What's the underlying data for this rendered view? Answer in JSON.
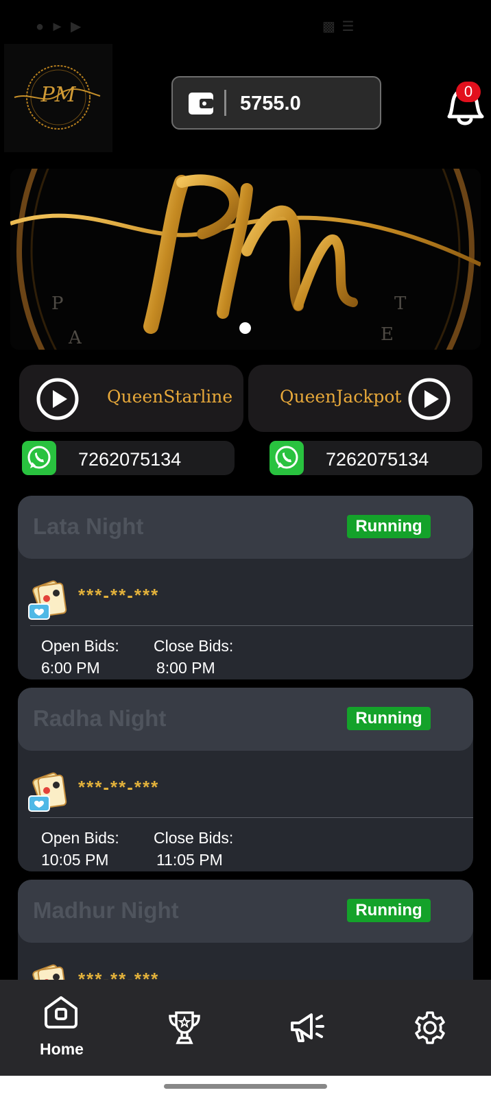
{
  "header": {
    "wallet_balance": "5755.0",
    "notification_count": "0"
  },
  "banner": {
    "icon": "pm-logo-banner"
  },
  "games": [
    {
      "label": "QueenStarline",
      "icon": "play-icon"
    },
    {
      "label": "QueenJackpot",
      "icon": "play-icon"
    }
  ],
  "contacts": [
    {
      "number": "7262075134",
      "icon": "whatsapp-icon"
    },
    {
      "number": "7262075134",
      "icon": "whatsapp-icon"
    }
  ],
  "markets": [
    {
      "name": "Lata Night",
      "status": "Running",
      "result": "***-**-***",
      "open_label": "Open Bids:",
      "open_time": "6:00 PM",
      "close_label": "Close Bids:",
      "close_time": "8:00 PM"
    },
    {
      "name": "Radha Night",
      "status": "Running",
      "result": "***-**-***",
      "open_label": "Open Bids:",
      "open_time": "10:05 PM",
      "close_label": "Close Bids:",
      "close_time": "11:05 PM"
    },
    {
      "name": "Madhur Night",
      "status": "Running",
      "result": "***-**-***"
    }
  ],
  "nav": [
    {
      "label": "Home",
      "icon": "home-icon",
      "active": true
    },
    {
      "label": "",
      "icon": "trophy-icon"
    },
    {
      "label": "",
      "icon": "megaphone-icon"
    },
    {
      "label": "",
      "icon": "gear-icon"
    }
  ],
  "colors": {
    "accent_gold": "#e8a93a",
    "running_green": "#14a22a",
    "badge_red": "#e2101d"
  }
}
